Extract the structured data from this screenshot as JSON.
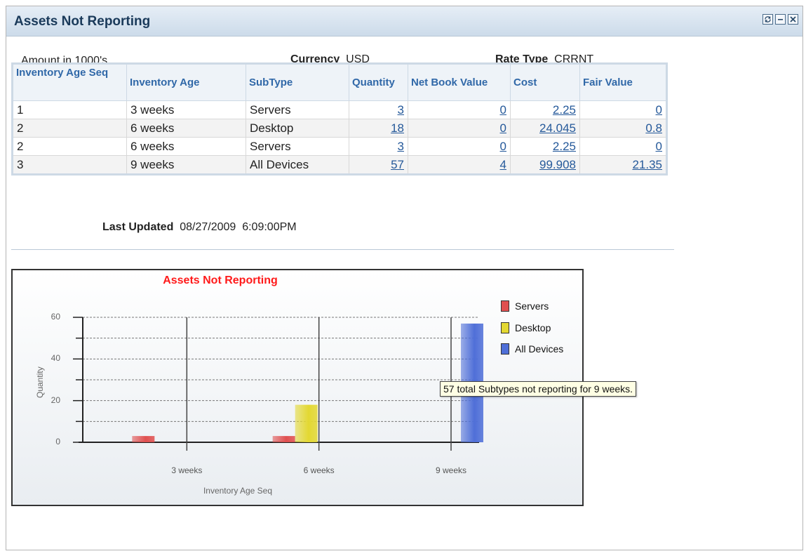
{
  "pagelet": {
    "title": "Assets Not Reporting",
    "buttons": {
      "refresh": "refresh-icon",
      "minimize": "minimize-icon",
      "close": "close-icon"
    }
  },
  "info": {
    "amount_text": "Amount in 1000's",
    "currency_label": "Currency",
    "currency_value": "USD",
    "rate_type_label": "Rate Type",
    "rate_type_value": "CRRNT"
  },
  "table": {
    "headers": [
      "Inventory Age Seq",
      "Inventory Age",
      "SubType",
      "Quantity",
      "Net Book Value",
      "Cost",
      "Fair Value"
    ],
    "rows": [
      {
        "seq": "1",
        "age": "3 weeks",
        "subtype": "Servers",
        "quantity": "3",
        "nbv": "0",
        "cost": "2.25",
        "fair": "0"
      },
      {
        "seq": "2",
        "age": "6 weeks",
        "subtype": "Desktop",
        "quantity": "18",
        "nbv": "0",
        "cost": "24.045",
        "fair": "0.8"
      },
      {
        "seq": "2",
        "age": "6 weeks",
        "subtype": "Servers",
        "quantity": "3",
        "nbv": "0",
        "cost": "2.25",
        "fair": "0"
      },
      {
        "seq": "3",
        "age": "9 weeks",
        "subtype": "All Devices",
        "quantity": "57",
        "nbv": "4",
        "cost": "99.908",
        "fair": "21.35"
      }
    ]
  },
  "last_updated": {
    "label": "Last Updated",
    "value": "08/27/2009  6:09:00PM"
  },
  "tooltip": "57 total  Subtypes not reporting for 9 weeks.",
  "chart_data": {
    "type": "bar",
    "title": "Assets Not Reporting",
    "xlabel": "Inventory Age Seq",
    "ylabel": "Quantity",
    "ylim": [
      0,
      60
    ],
    "yticks": [
      "0",
      "20",
      "40",
      "60"
    ],
    "categories": [
      "3 weeks",
      "6 weeks",
      "9 weeks"
    ],
    "series": [
      {
        "name": "Servers",
        "values": [
          3,
          3,
          0
        ],
        "color": "#e05050"
      },
      {
        "name": "Desktop",
        "values": [
          0,
          18,
          0
        ],
        "color": "#e3d832"
      },
      {
        "name": "All Devices",
        "values": [
          0,
          0,
          57
        ],
        "color": "#4f6fd8"
      }
    ],
    "legend_position": "right",
    "grid": true
  }
}
